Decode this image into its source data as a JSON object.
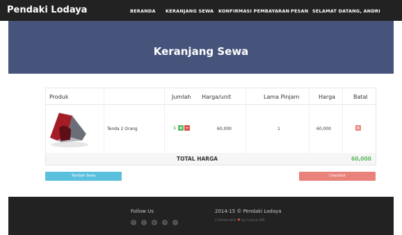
{
  "brand": "Pendaki Lodaya",
  "nav": {
    "items": [
      "BERANDA",
      "KERANJANG SEWA",
      "KONFIRMASI PEMBAYARAN",
      "PESAN",
      "SELAMAT DATANG, ANDRI"
    ]
  },
  "hero": {
    "title": "Keranjang Sewa"
  },
  "table": {
    "headers": {
      "produk": "Produk",
      "jumlah": "Jumlah",
      "harga_unit": "Harga/unit",
      "lama": "Lama Pinjam",
      "harga": "Harga",
      "batal": "Batal"
    },
    "row": {
      "name": "Tenda 2 Orang",
      "qty": "1",
      "unit_price": "60,000",
      "lama": "1",
      "price": "60,000"
    },
    "total_label": "TOTAL HARGA",
    "total_value": "60,000"
  },
  "buttons": {
    "tambah": "Tambah Sewa",
    "checkout": "Checkout"
  },
  "footer": {
    "follow": "Follow Us",
    "copyright": "2014-15 © Pendaki Lodaya",
    "crafted_prefix": "Crafted with",
    "crafted_suffix": "by Canya SW"
  },
  "colors": {
    "hero": "#46537a",
    "accent_green": "#5cb85c",
    "accent_red": "#d9534f",
    "tambah_btn": "#5bc0de",
    "checkout_btn": "#e8827a"
  }
}
